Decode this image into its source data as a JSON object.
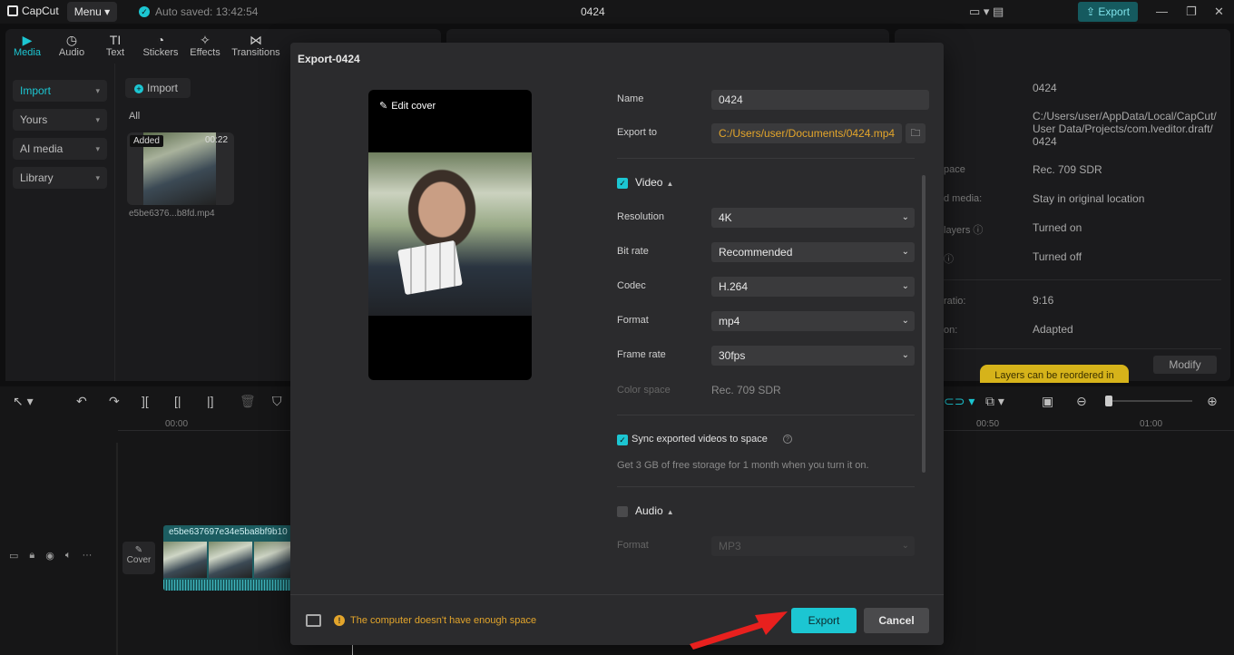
{
  "app": {
    "logo_text": "CapCut",
    "menu_label": "Menu",
    "autosave_text": "Auto saved: 13:42:54",
    "project_title": "0424",
    "top_export_label": "Export"
  },
  "tools": [
    {
      "label": "Media",
      "icon": "media-icon"
    },
    {
      "label": "Audio",
      "icon": "audio-icon"
    },
    {
      "label": "Text",
      "icon": "text-icon"
    },
    {
      "label": "Stickers",
      "icon": "stickers-icon"
    },
    {
      "label": "Effects",
      "icon": "effects-icon"
    },
    {
      "label": "Transitions",
      "icon": "transitions-icon"
    }
  ],
  "left_nav": {
    "items": [
      {
        "label": "Import"
      },
      {
        "label": "Yours"
      },
      {
        "label": "AI media"
      },
      {
        "label": "Library"
      }
    ],
    "import_button": "Import",
    "all_label": "All"
  },
  "media": {
    "added_tag": "Added",
    "duration": "00:22",
    "filename": "e5be6376...b8fd.mp4"
  },
  "right_panel": {
    "labels": [
      "pace",
      "d media:",
      "layers",
      "",
      "ratio:",
      "on:"
    ],
    "values": {
      "name": "0424",
      "path_1": "C:/Users/user/AppData/Local/CapCut/",
      "path_2": "User Data/Projects/com.lveditor.draft/",
      "path_3": "0424",
      "color_space": "Rec. 709 SDR",
      "imported_media": "Stay in original location",
      "proxy": "Turned on",
      "layers": "Turned off",
      "ratio": "9:16",
      "resolution": "Adapted"
    },
    "modify_label": "Modify",
    "tooltip": "Layers can be reordered in"
  },
  "timeline": {
    "ticks": [
      "00:00",
      "00:50",
      "01:00"
    ],
    "clip_name": "e5be637697e34e5ba8bf9b10",
    "cover_label": "Cover"
  },
  "modal": {
    "title": "Export-0424",
    "edit_cover": "Edit cover",
    "name_label": "Name",
    "name_value": "0424",
    "export_to_label": "Export to",
    "export_to_value": "C:/Users/user/Documents/0424.mp4",
    "video_section": "Video",
    "resolution_label": "Resolution",
    "resolution_value": "4K",
    "bitrate_label": "Bit rate",
    "bitrate_value": "Recommended",
    "codec_label": "Codec",
    "codec_value": "H.264",
    "format_label": "Format",
    "format_value": "mp4",
    "framerate_label": "Frame rate",
    "framerate_value": "30fps",
    "colorspace_label": "Color space",
    "colorspace_value": "Rec. 709 SDR",
    "sync_label": "Sync exported videos to space",
    "sync_note": "Get 3 GB of free storage for 1 month when you turn it on.",
    "audio_section": "Audio",
    "audio_format_label": "Format",
    "audio_format_value": "MP3",
    "warning": "The computer doesn't have enough space",
    "export_button": "Export",
    "cancel_button": "Cancel"
  },
  "colors": {
    "accent": "#1cc6d2",
    "warning": "#e3a52b",
    "arrow": "#e8201e"
  }
}
